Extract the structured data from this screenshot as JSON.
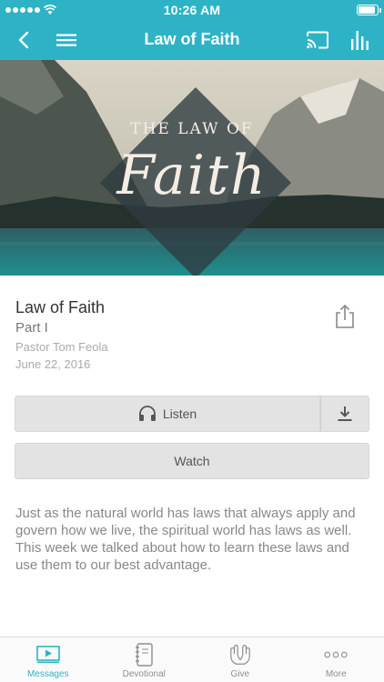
{
  "status_bar": {
    "time": "10:26 AM"
  },
  "nav": {
    "title": "Law of Faith"
  },
  "hero": {
    "line1": "THE LAW OF",
    "line2": "Faith"
  },
  "message": {
    "title": "Law of Faith",
    "part": "Part I",
    "speaker": "Pastor Tom Feola",
    "date": "June 22, 2016"
  },
  "actions": {
    "listen_label": "Listen",
    "watch_label": "Watch"
  },
  "description": "Just as the natural world has laws that always apply and govern how we live, the spiritual world has laws as well. This week we talked about how to learn these laws and use them to our best advantage.",
  "tabs": [
    {
      "label": "Messages",
      "icon": "video-icon",
      "active": true
    },
    {
      "label": "Devotional",
      "icon": "notebook-icon",
      "active": false
    },
    {
      "label": "Give",
      "icon": "hands-icon",
      "active": false
    },
    {
      "label": "More",
      "icon": "more-dots-icon",
      "active": false
    }
  ],
  "colors": {
    "accent": "#2eb3c6",
    "button_bg": "#e3e3e3",
    "text_muted": "#aaaaaa"
  }
}
